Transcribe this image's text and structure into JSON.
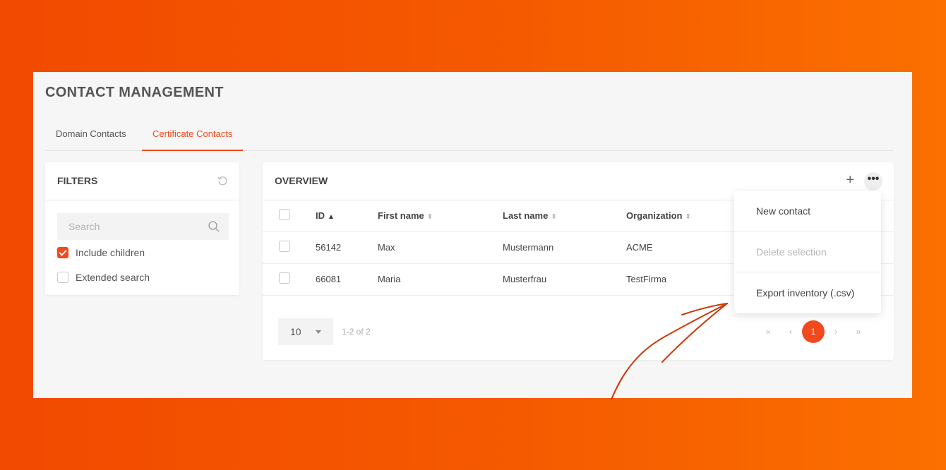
{
  "page": {
    "title": "CONTACT MANAGEMENT"
  },
  "tabs": [
    {
      "label": "Domain Contacts",
      "active": false
    },
    {
      "label": "Certificate Contacts",
      "active": true
    }
  ],
  "filters": {
    "title": "FILTERS",
    "search_placeholder": "Search",
    "options": [
      {
        "label": "Include children",
        "checked": true
      },
      {
        "label": "Extended search",
        "checked": false
      }
    ]
  },
  "overview": {
    "title": "OVERVIEW",
    "columns": [
      {
        "label": "ID",
        "sort": "asc"
      },
      {
        "label": "First name",
        "sort": "none"
      },
      {
        "label": "Last name",
        "sort": "none"
      },
      {
        "label": "Organization",
        "sort": "none"
      }
    ],
    "rows": [
      {
        "id": "56142",
        "first_name": "Max",
        "last_name": "Mustermann",
        "organization": "ACME"
      },
      {
        "id": "66081",
        "first_name": "Maria",
        "last_name": "Musterfrau",
        "organization": "TestFirma"
      }
    ],
    "page_size": "10",
    "range_text": "1-2 of 2",
    "current_page": "1"
  },
  "menu": {
    "items": [
      {
        "label": "New contact",
        "disabled": false
      },
      {
        "label": "Delete selection",
        "disabled": true
      },
      {
        "label": "Export inventory (.csv)",
        "disabled": false
      }
    ]
  },
  "colors": {
    "accent": "#f24a1c",
    "background_start": "#f24a00",
    "background_end": "#fb7000"
  }
}
